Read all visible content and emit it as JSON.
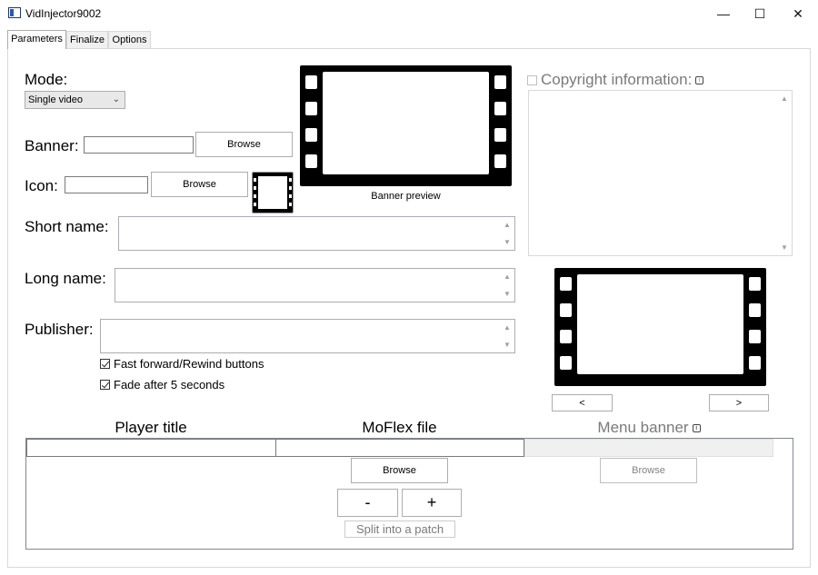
{
  "window": {
    "title": "VidInjector9002",
    "minimize_glyph": "—",
    "maximize_glyph": "☐",
    "close_glyph": "✕"
  },
  "tabs": [
    {
      "label": "Parameters",
      "active": true
    },
    {
      "label": "Finalize",
      "active": false
    },
    {
      "label": "Options",
      "active": false
    }
  ],
  "parameters": {
    "mode_label": "Mode:",
    "mode_value": "Single video",
    "banner_label": "Banner:",
    "banner_value": "",
    "banner_browse": "Browse",
    "icon_label": "Icon:",
    "icon_value": "",
    "icon_browse": "Browse",
    "banner_preview_caption": "Banner preview",
    "short_name_label": "Short name:",
    "short_name_value": "",
    "long_name_label": "Long name:",
    "long_name_value": "",
    "publisher_label": "Publisher:",
    "publisher_value": "",
    "fast_forward_label": "Fast forward/Rewind buttons",
    "fast_forward_checked": true,
    "fade_label": "Fade after 5 seconds",
    "fade_checked": true,
    "copyright_label": "Copyright information:",
    "copyright_checked": false,
    "copyright_info_icon": "info-icon",
    "copyright_value": "",
    "prev_button": "<",
    "next_button": ">"
  },
  "video_table": {
    "player_title_header": "Player title",
    "moflex_header": "MoFlex file",
    "menu_banner_header": "Menu banner",
    "menu_banner_info_icon": "info-icon",
    "rows": [
      {
        "player_title": "",
        "moflex_file": "",
        "menu_banner": ""
      }
    ],
    "moflex_browse": "Browse",
    "menu_banner_browse": "Browse",
    "remove_button": "-",
    "add_button": "+",
    "split_button": "Split into a patch"
  },
  "colors": {
    "disabled_text": "#7a7a7a",
    "film_frame": "#000000",
    "border": "#adadad"
  }
}
